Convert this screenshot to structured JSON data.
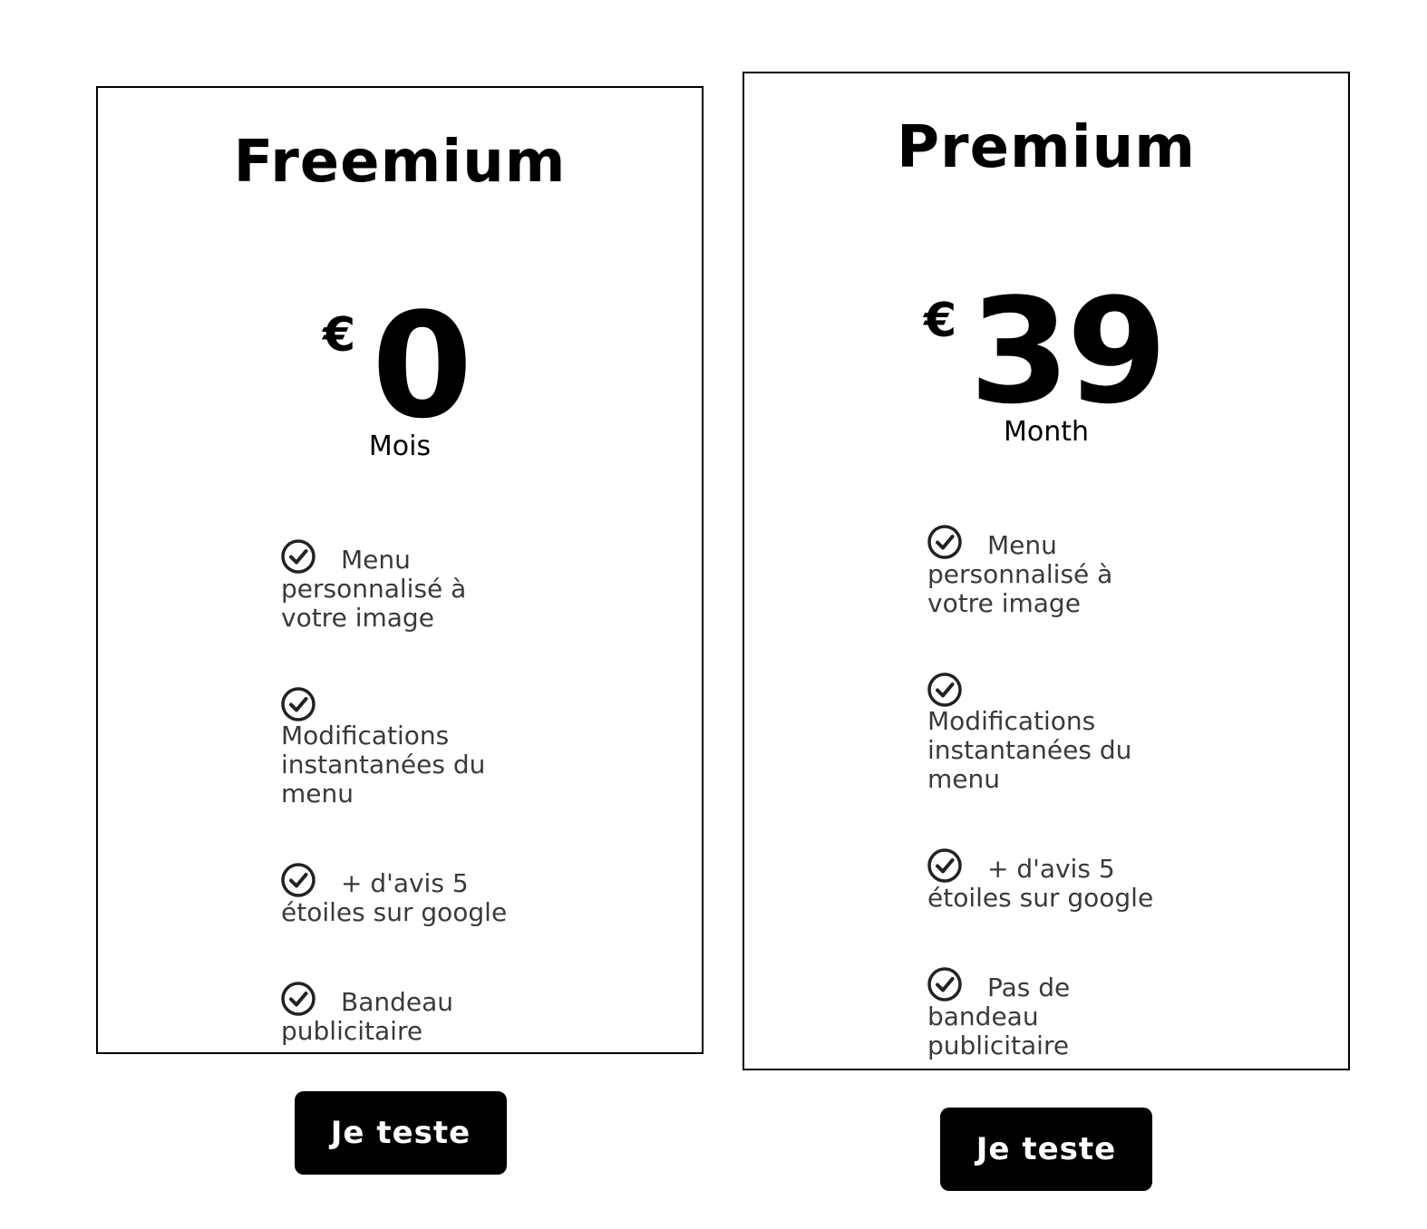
{
  "plans": [
    {
      "title": "Freemium",
      "currency": "€",
      "amount": "0",
      "period": "Mois",
      "features": [
        "Menu personnalisé à votre image",
        "Modifications instantanées du menu",
        "+ d'avis 5 étoiles sur google",
        "Bandeau publicitaire"
      ],
      "cta_label": "Je teste"
    },
    {
      "title": "Premium",
      "currency": "€",
      "amount": "39",
      "period": "Month",
      "features": [
        "Menu personnalisé à votre image",
        "Modifications instantanées du menu",
        "+ d'avis 5 étoiles sur google",
        "Pas de bandeau publicitaire"
      ],
      "cta_label": "Je teste"
    }
  ],
  "icons": {
    "feature_check": "check-circle-icon"
  }
}
